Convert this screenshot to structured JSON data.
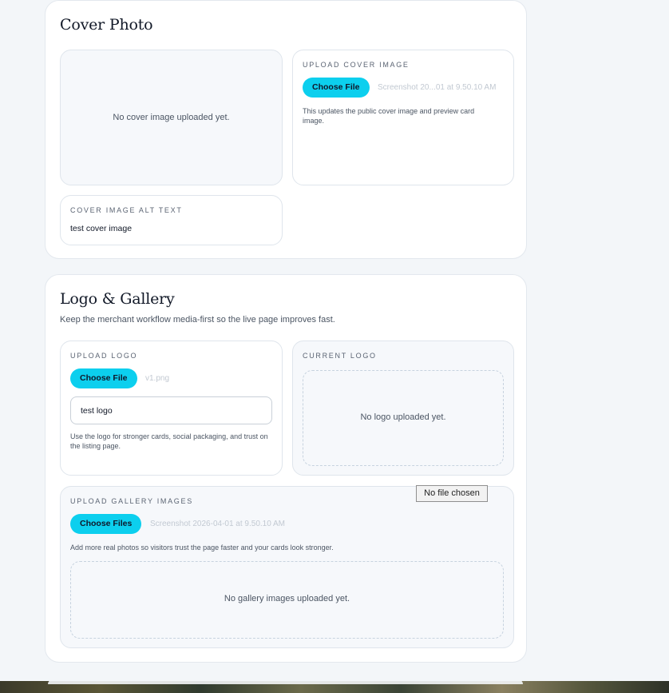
{
  "cover": {
    "title": "Cover Photo",
    "preview_empty": "No cover image uploaded yet.",
    "upload": {
      "label": "UPLOAD COVER IMAGE",
      "button": "Choose File",
      "filename": "Screenshot 20...01 at 9.50.10 AM",
      "help": "This updates the public cover image and preview card image."
    },
    "alt": {
      "label": "COVER IMAGE ALT TEXT",
      "value": "test cover image"
    }
  },
  "logo_gallery": {
    "title": "Logo & Gallery",
    "subtitle": "Keep the merchant workflow media-first so the live page improves fast.",
    "upload_logo": {
      "label": "UPLOAD LOGO",
      "button": "Choose File",
      "filename": "v1.png",
      "input_value": "test logo",
      "help": "Use the logo for stronger cards, social packaging, and trust on the listing page."
    },
    "current_logo": {
      "label": "CURRENT LOGO",
      "empty": "No logo uploaded yet."
    },
    "gallery": {
      "label": "UPLOAD GALLERY IMAGES",
      "button": "Choose Files",
      "filename": "Screenshot 2026-04-01 at 9.50.10 AM",
      "help": "Add more real photos so visitors trust the page faster and your cards look stronger.",
      "empty": "No gallery images uploaded yet."
    }
  },
  "tooltip": "No file chosen",
  "colors": {
    "accent": "#0ccfee",
    "page_bg": "#f3f6f9",
    "card_bg": "#ffffff",
    "border": "#dfe5ec"
  }
}
